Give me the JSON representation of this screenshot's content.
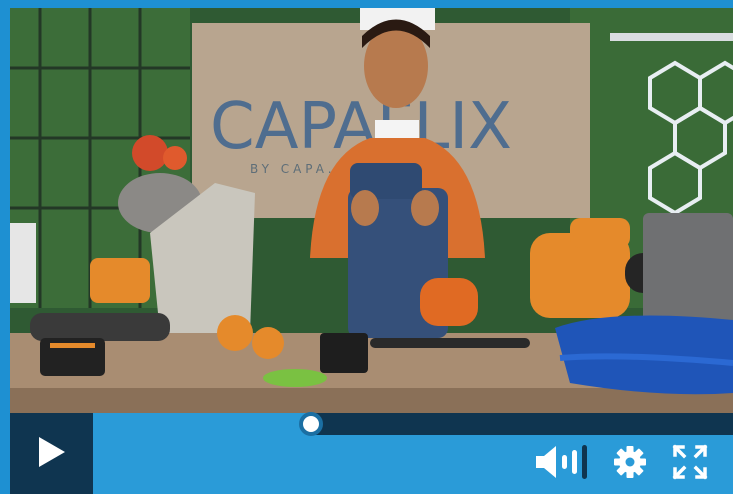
{
  "video": {
    "sign_text": "CAPAFLIX",
    "sign_subtext": "BY CAPA... MEDICINE"
  },
  "player": {
    "progress": 0.34,
    "icons": {
      "play": "play-icon",
      "volume": "volume-icon",
      "settings": "gear-icon",
      "fullscreen": "fullscreen-icon"
    },
    "colors": {
      "bar": "#2a9bd8",
      "dark": "#0f3550",
      "handle_ring": "#1b6fa3"
    }
  }
}
